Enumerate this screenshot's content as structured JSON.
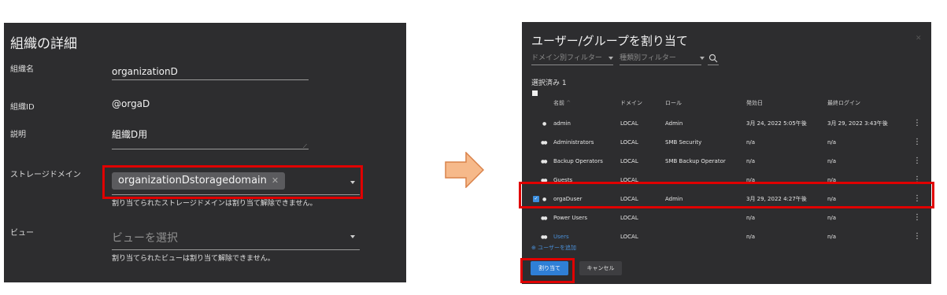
{
  "left_panel": {
    "title": "組織の詳細",
    "org_name_label": "組織名",
    "org_name_value": "organizationD",
    "org_id_label": "組織ID",
    "org_id_value": "@orgaD",
    "description_label": "説明",
    "description_value": "組織D用",
    "storage_domain_label": "ストレージドメイン",
    "storage_domain_chip": "organizationDstoragedomain",
    "storage_domain_remove_glyph": "✕",
    "storage_domain_hint": "割り当てられたストレージドメインは割り当て解除できません。",
    "view_label": "ビュー",
    "view_placeholder": "ビューを選択",
    "view_hint": "割り当てられたビューは割り当て解除できません。"
  },
  "right_panel": {
    "title": "ユーザー/グループを割り当て",
    "domain_filter_placeholder": "ドメイン別フィルター",
    "type_filter_placeholder": "種類別フィルター",
    "selected_label": "選択済み 1",
    "columns": [
      "名前",
      "ドメイン",
      "ロール",
      "発効日",
      "最終ログイン"
    ],
    "rows": [
      {
        "name": "admin",
        "type": "user",
        "domain": "LOCAL",
        "role": "Admin",
        "effective": "3月 24, 2022 5:05午後",
        "last_login": "3月 29, 2022 3:43午後",
        "checked": false
      },
      {
        "name": "Administrators",
        "type": "group",
        "domain": "LOCAL",
        "role": "SMB Security",
        "effective": "n/a",
        "last_login": "n/a",
        "checked": false
      },
      {
        "name": "Backup Operators",
        "type": "group",
        "domain": "LOCAL",
        "role": "SMB Backup Operator",
        "effective": "n/a",
        "last_login": "n/a",
        "checked": false
      },
      {
        "name": "Guests",
        "type": "group",
        "domain": "LOCAL",
        "role": "",
        "effective": "n/a",
        "last_login": "n/a",
        "checked": false
      },
      {
        "name": "orgaDuser",
        "type": "user",
        "domain": "LOCAL",
        "role": "Admin",
        "effective": "3月 29, 2022 4:27午後",
        "last_login": "n/a",
        "checked": true
      },
      {
        "name": "Power Users",
        "type": "group",
        "domain": "LOCAL",
        "role": "",
        "effective": "n/a",
        "last_login": "n/a",
        "checked": false
      },
      {
        "name": "Users",
        "type": "group",
        "domain": "LOCAL",
        "role": "",
        "effective": "n/a",
        "last_login": "n/a",
        "checked": false,
        "link": true
      }
    ],
    "add_user_link": "ユーザーを追加",
    "assign_button": "割り当て",
    "cancel_button": "キャンセル"
  },
  "colors": {
    "panel_bg": "#2d2d2f",
    "highlight_red": "#e00000",
    "primary_blue": "#2f7fd6",
    "arrow_fill": "#f6b98a",
    "arrow_stroke": "#d9824a"
  }
}
